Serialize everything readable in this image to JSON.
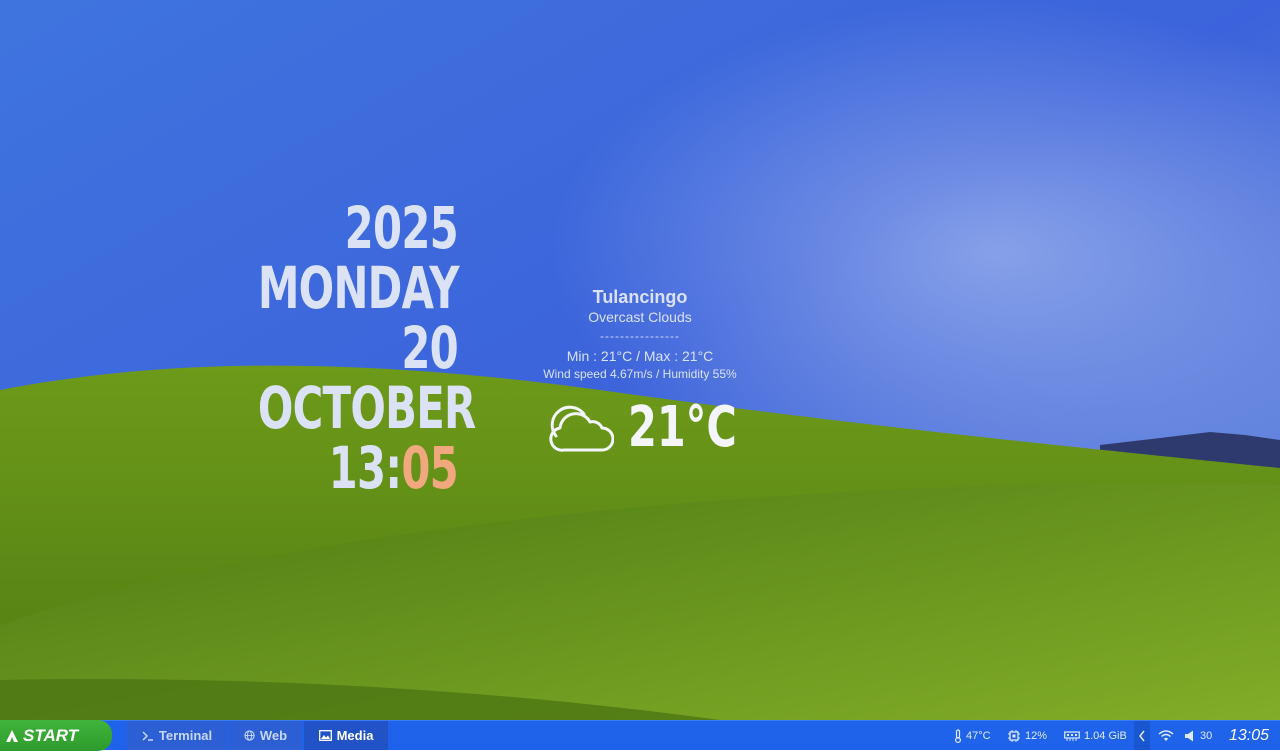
{
  "clock_widget": {
    "year": "2025",
    "weekday": "MONDAY",
    "day": "20",
    "month": "OCTOBER",
    "hour": "13:",
    "minute": "05",
    "minute_color": "#f0a97e"
  },
  "weather": {
    "city": "Tulancingo",
    "condition": "Overcast Clouds",
    "separator": "----------------",
    "min_max": "Min : 21°C / Max : 21°C",
    "wind_humidity": "Wind speed 4.67m/s / Humidity 55%",
    "temperature": "21°C",
    "icon": "cloud-icon"
  },
  "taskbar": {
    "start_label": "START",
    "tasks": [
      {
        "label": "Terminal",
        "icon": "terminal-icon"
      },
      {
        "label": "Web",
        "icon": "globe-icon"
      },
      {
        "label": "Media",
        "icon": "image-icon",
        "active": true
      }
    ],
    "tray": {
      "cpu_temp": "47°C",
      "cpu_usage": "12%",
      "memory": "1.04 GiB",
      "volume": "30",
      "clock": "13:05"
    }
  },
  "colors": {
    "taskbar": "#1f63ea",
    "start_button": "#3fb43b",
    "active_task": "#2152c6"
  }
}
